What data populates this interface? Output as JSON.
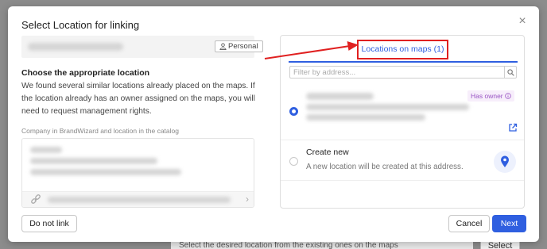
{
  "backdrop": {
    "hint_text": "Select the desired location from the existing ones on the maps",
    "select_label": "Select"
  },
  "modal": {
    "title": "Select Location for linking",
    "close_icon": "close-icon",
    "account_badge": "Personal",
    "heading": "Choose the appropriate location",
    "description": "We found several similar locations already placed on the maps. If the location already has an owner assigned on the maps, you will need to request management rights.",
    "company_caption": "Company in BrandWizard and location in the catalog",
    "tab_label": "Locations on maps (1)",
    "filter_placeholder": "Filter by address...",
    "owner_badge": "Has owner",
    "create_new_title": "Create new",
    "create_new_desc": "A new location will be created at this address.",
    "buttons": {
      "do_not_link": "Do not link",
      "cancel": "Cancel",
      "next": "Next"
    },
    "colors": {
      "accent": "#2f5fe0",
      "highlight": "#e02020",
      "owner": "#9a55c4"
    }
  }
}
